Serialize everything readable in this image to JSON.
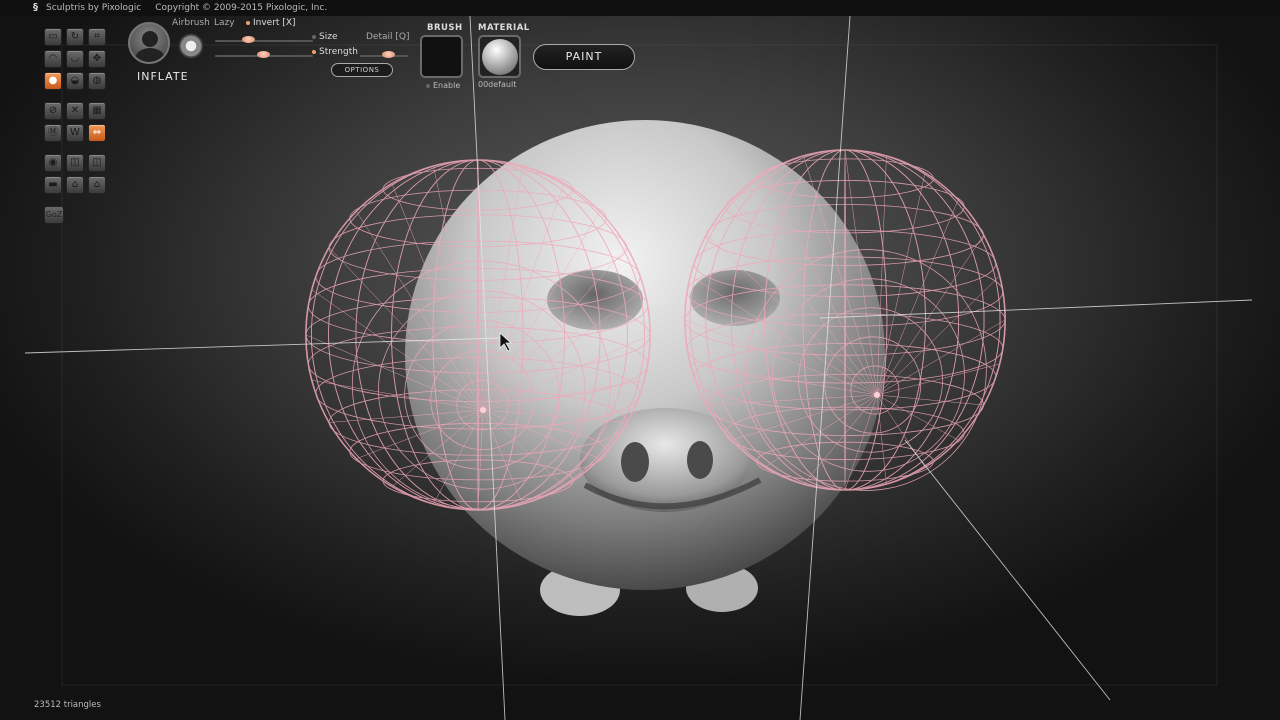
{
  "titlebar": {
    "title": "Sculptris by Pixologic",
    "copyright": "Copyright © 2009-2015 Pixologic, Inc."
  },
  "brush_panel": {
    "brush_name": "INFLATE",
    "airbrush_label": "Airbrush",
    "lazy_label": "Lazy",
    "invert_label": "Invert [X]",
    "size_label": "Size",
    "strength_label": "Strength",
    "detail_label": "Detail [Q]",
    "options_label": "OPTIONS"
  },
  "swatches": {
    "brush_header": "BRUSH",
    "material_header": "MATERIAL",
    "enable_label": "Enable",
    "material_name": "00default"
  },
  "paint_button": {
    "label": "PAINT"
  },
  "goz_label": "GoZ",
  "toolbar_icons": [
    "grab-icon",
    "rotate-icon",
    "crop-icon",
    "draw-icon",
    "crease-icon",
    "move-icon",
    "inflate-icon",
    "pinch-icon",
    "smooth-icon",
    "symmetry-icon",
    "wireframe-icon",
    "grid-icon",
    "mask-icon",
    "reduce-icon",
    "mirror-icon",
    "sphere-icon",
    "new-plane-icon",
    "open-icon",
    "save-icon",
    "import-icon",
    "export-icon"
  ],
  "status": {
    "triangles": "23512 triangles"
  },
  "colors": {
    "active_tool": "#e07a3a",
    "wire_overlay": "#f0a8b8"
  }
}
